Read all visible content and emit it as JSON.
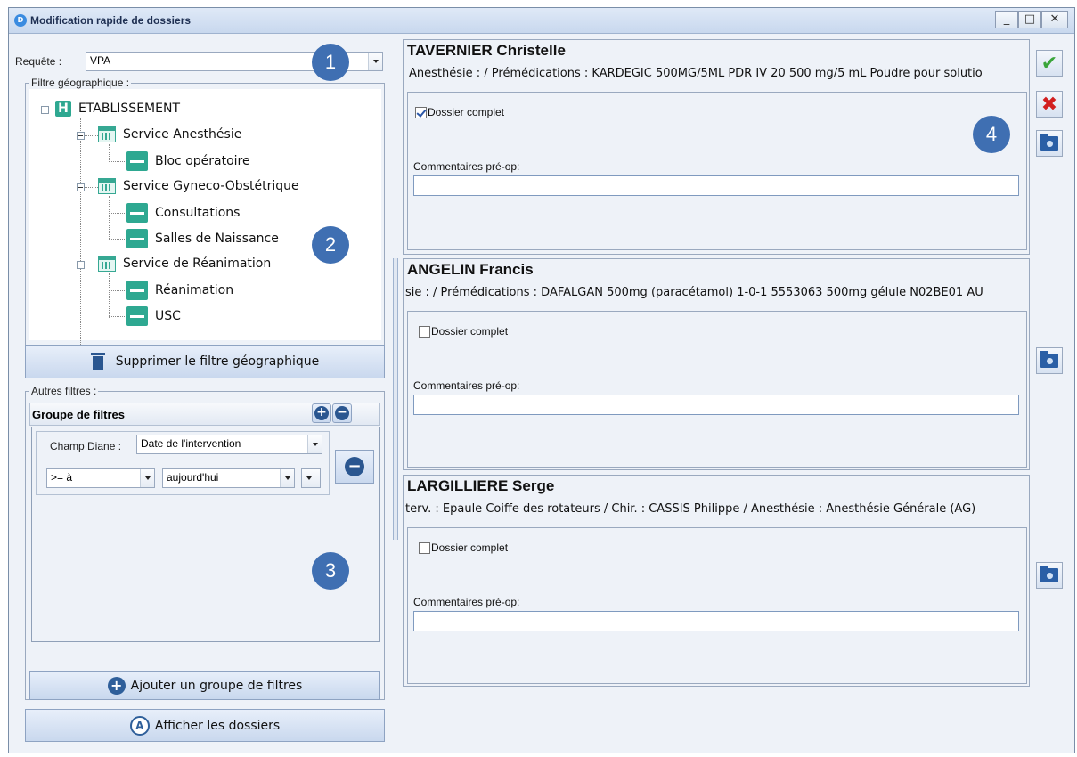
{
  "window": {
    "title": "Modification rapide de dossiers",
    "app_icon": "D",
    "minimize": "_",
    "maximize": "□",
    "close": "✕"
  },
  "left": {
    "request_label": "Requête :",
    "request_value": "VPA",
    "geo_filter_legend": "Filtre géographique :",
    "tree": {
      "root": "ETABLISSEMENT",
      "services": [
        {
          "label": "Service Anesthésie",
          "units": [
            "Bloc opératoire"
          ]
        },
        {
          "label": "Service Gyneco-Obstétrique",
          "units": [
            "Consultations",
            "Salles de Naissance"
          ]
        },
        {
          "label": "Service de Réanimation",
          "units": [
            "Réanimation",
            "USC"
          ]
        }
      ]
    },
    "delete_geo_filter_label": "Supprimer le filtre géographique",
    "other_filters_legend": "Autres filtres :",
    "filter_group_title": "Groupe de filtres",
    "champ_label": "Champ Diane :",
    "champ_value": "Date de l'intervention",
    "operator_value": ">= à",
    "date_value": "aujourd'hui",
    "add_group_label": "Ajouter un groupe de filtres",
    "show_folders_label": "Afficher les dossiers"
  },
  "badges": [
    "1",
    "2",
    "3",
    "4"
  ],
  "patients": [
    {
      "name": "TAVERNIER Christelle",
      "info": "Anesthésie :  / Prémédications : KARDEGIC 500MG/5ML PDR IV 20 500 mg/5 mL Poudre pour solutio",
      "complete_label": "Dossier complet",
      "complete_checked": true,
      "comments_label": "Commentaires pré-op:",
      "comments_value": ""
    },
    {
      "name": "ANGELIN Francis",
      "info": "sie :  / Prémédications : DAFALGAN 500mg (paracétamol) 1-0-1 5553063 500mg gélule N02BE01 AU",
      "complete_label": "Dossier complet",
      "complete_checked": false,
      "comments_label": "Commentaires pré-op:",
      "comments_value": ""
    },
    {
      "name": "LARGILLIERE Serge",
      "info": "terv. : Epaule Coiffe des rotateurs / Chir. : CASSIS Philippe / Anesthésie : Anesthésie Générale (AG)",
      "complete_label": "Dossier complet",
      "complete_checked": false,
      "comments_label": "Commentaires pré-op:",
      "comments_value": ""
    }
  ],
  "actions": {
    "validate_icon": "check-icon",
    "cancel_icon": "cross-icon",
    "folder_icon": "folder-icon"
  },
  "colors": {
    "accent": "#3f6fb2",
    "tree_icon": "#2ea891",
    "validate": "#3aa53a",
    "cancel": "#d21f1f"
  }
}
